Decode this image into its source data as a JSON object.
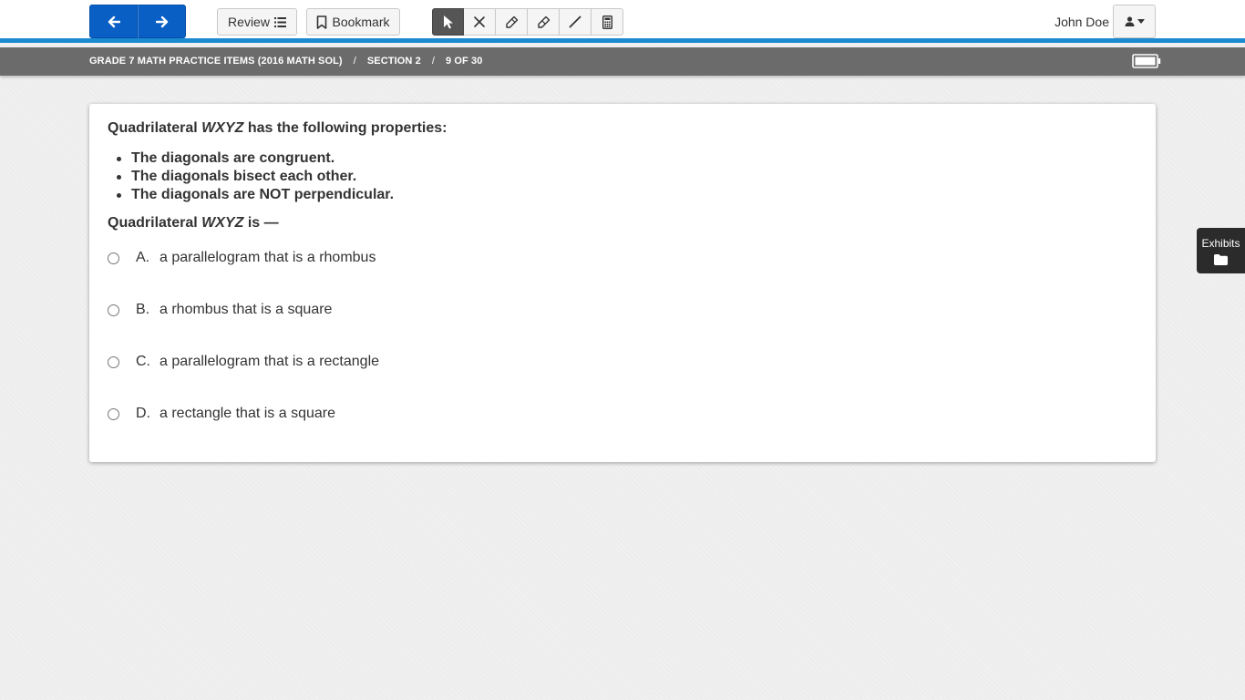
{
  "toolbar": {
    "review_label": "Review",
    "bookmark_label": "Bookmark",
    "tools": [
      "pointer-icon",
      "eliminate-icon",
      "highlighter-icon",
      "eraser-icon",
      "line-icon",
      "calculator-icon"
    ]
  },
  "user": {
    "name": "John Doe"
  },
  "breadcrumb": {
    "test": "GRADE 7 MATH PRACTICE ITEMS (2016 MATH SOL)",
    "section": "SECTION 2",
    "progress": "9 OF 30",
    "separator": "/"
  },
  "question": {
    "stem_prefix": "Quadrilateral ",
    "stem_var": "WXYZ",
    "stem_suffix": " has the following properties:",
    "properties": [
      "The diagonals are congruent.",
      "The diagonals bisect each other.",
      "The diagonals are NOT perpendicular."
    ],
    "prompt_prefix": "Quadrilateral ",
    "prompt_var": "WXYZ",
    "prompt_suffix": " is —",
    "choices": [
      {
        "letter": "A.",
        "text": "a parallelogram that is a rhombus"
      },
      {
        "letter": "B.",
        "text": "a rhombus that is a square"
      },
      {
        "letter": "C.",
        "text": "a parallelogram that is a rectangle"
      },
      {
        "letter": "D.",
        "text": "a rectangle that is a square"
      }
    ]
  },
  "exhibits": {
    "label": "Exhibits"
  },
  "colors": {
    "nav_blue": "#0a5fc5",
    "accent_line": "#1c8ad0",
    "subbar": "#6b6b6b"
  }
}
